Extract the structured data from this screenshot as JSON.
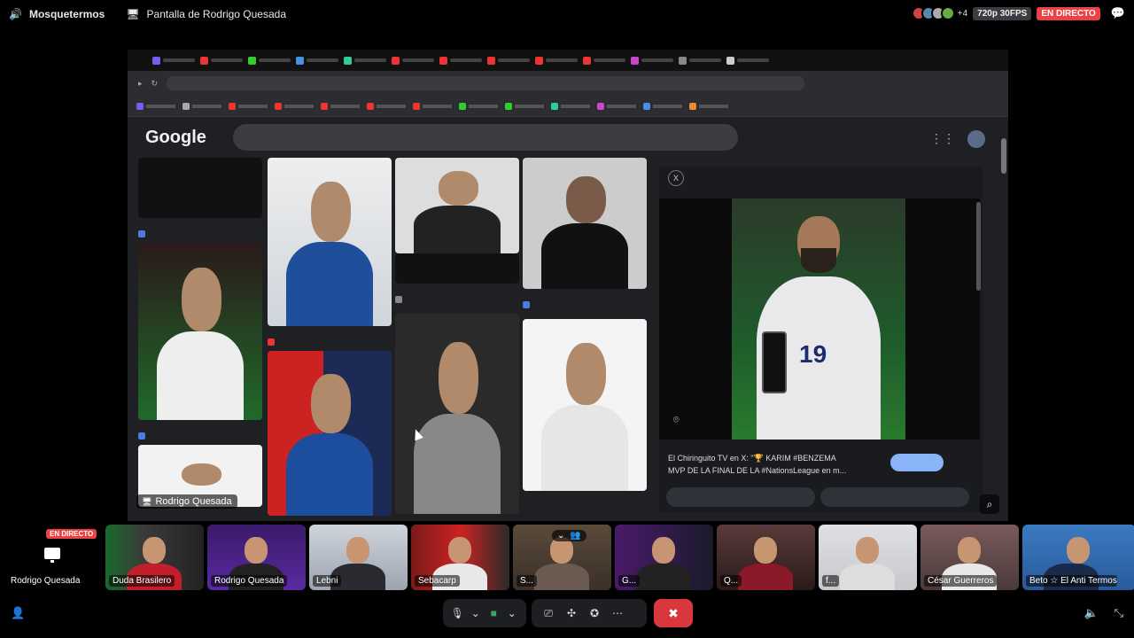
{
  "topbar": {
    "channel": "Mosquetermos",
    "stream_title": "Pantalla de Rodrigo Quesada",
    "extra_viewers": "+4",
    "quality": "720p 30FPS",
    "live": "EN DIRECTO"
  },
  "browser": {
    "logo": "Google",
    "preview_caption_line1": "El Chiringuito TV en X: \"🏆 KARIM #BENZEMA",
    "preview_caption_line2": "MVP DE LA FINAL DE LA #NationsLeague en m..."
  },
  "stream": {
    "name_tag": "Rodrigo Quesada"
  },
  "participants": [
    {
      "label": "Rodrigo Quesada",
      "live": "EN DIRECTO"
    },
    {
      "label": "Duda Brasilero"
    },
    {
      "label": "Rodrigo Quesada"
    },
    {
      "label": "Lebni"
    },
    {
      "label": "Sebacarp"
    },
    {
      "label": "S..."
    },
    {
      "label": "G..."
    },
    {
      "label": "Q..."
    },
    {
      "label": "f..."
    },
    {
      "label": "César Guerreros"
    },
    {
      "label": "Beto ☆ El Anti Termos ᴀʀ"
    }
  ],
  "colors": {
    "live_red": "#ed4245",
    "speaking_green": "#3ba55c",
    "hangup_red": "#da373c"
  }
}
